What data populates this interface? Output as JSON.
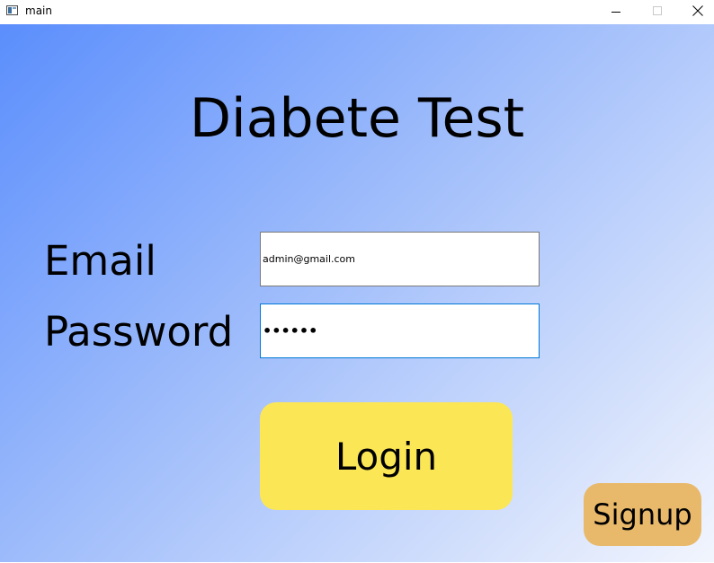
{
  "window": {
    "title": "main",
    "icon": "app-window-icon",
    "controls": {
      "minimize_icon": "minimize-icon",
      "maximize_icon": "maximize-icon",
      "close_icon": "close-icon"
    }
  },
  "form": {
    "heading": "Diabete Test",
    "email_label": "Email",
    "email_value": "admin@gmail.com",
    "password_label": "Password",
    "password_value": "••••••",
    "login_label": "Login",
    "signup_label": "Signup"
  },
  "colors": {
    "gradient_start": "#5b8efc",
    "gradient_end": "#f2f5fd",
    "login_button": "#fbe655",
    "signup_button": "#e8b96a",
    "focus_border": "#0078d7"
  }
}
